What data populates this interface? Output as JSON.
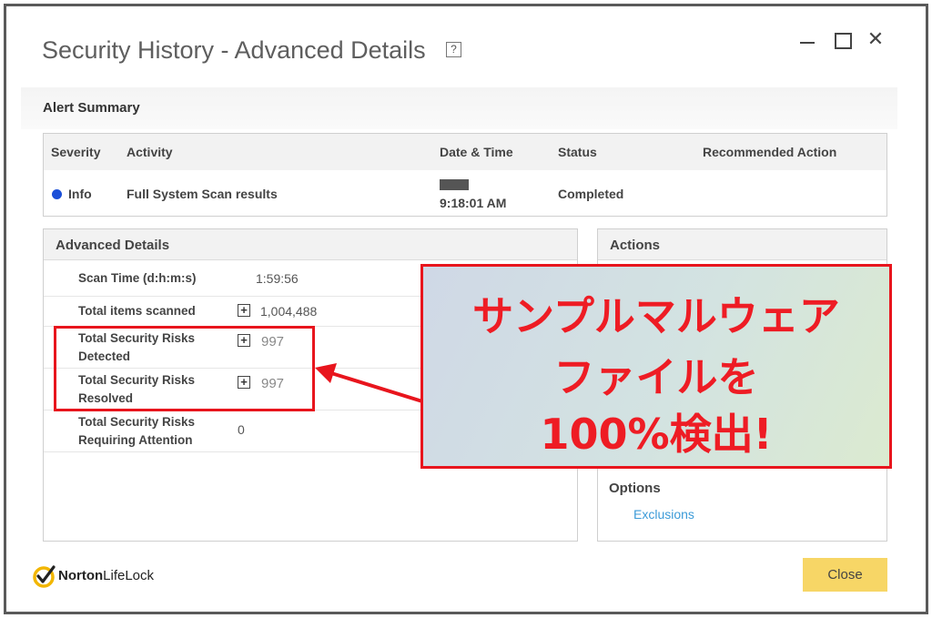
{
  "window": {
    "title": "Security History - Advanced Details",
    "help_label": "?",
    "close_glyph": "✕"
  },
  "alert_summary": {
    "title": "Alert Summary",
    "headers": [
      "Severity",
      "Activity",
      "Date & Time",
      "Status",
      "Recommended Action"
    ],
    "row": {
      "severity": "Info",
      "activity": "Full System Scan results",
      "time": "9:18:01 AM",
      "status": "Completed",
      "recommended_action": ""
    }
  },
  "advanced_details": {
    "title": "Advanced Details",
    "rows": [
      {
        "label": "Scan Time (d:h:m:s)",
        "value": "1:59:56"
      },
      {
        "label": "Total items scanned",
        "value": "1,004,488"
      },
      {
        "label": "Total Security Risks Detected",
        "value": "997"
      },
      {
        "label": "Total Security Risks Resolved",
        "value": "997"
      },
      {
        "label": "Total Security Risks Requiring Attention",
        "value": "0"
      }
    ],
    "expand_glyph": "+"
  },
  "actions": {
    "title": "Actions"
  },
  "options": {
    "title": "Options",
    "exclusions_link": "Exclusions"
  },
  "callout": {
    "line1": "サンプルマルウェア",
    "line2": "ファイルを",
    "line3": "100%検出!"
  },
  "footer": {
    "brand_norton": "Norton",
    "brand_lifelock": "LifeLock",
    "close_label": "Close"
  },
  "colors": {
    "accent_red": "#e8151d",
    "close_button": "#f7d666",
    "link": "#3c9bd8",
    "info_dot": "#1b4fd8"
  }
}
